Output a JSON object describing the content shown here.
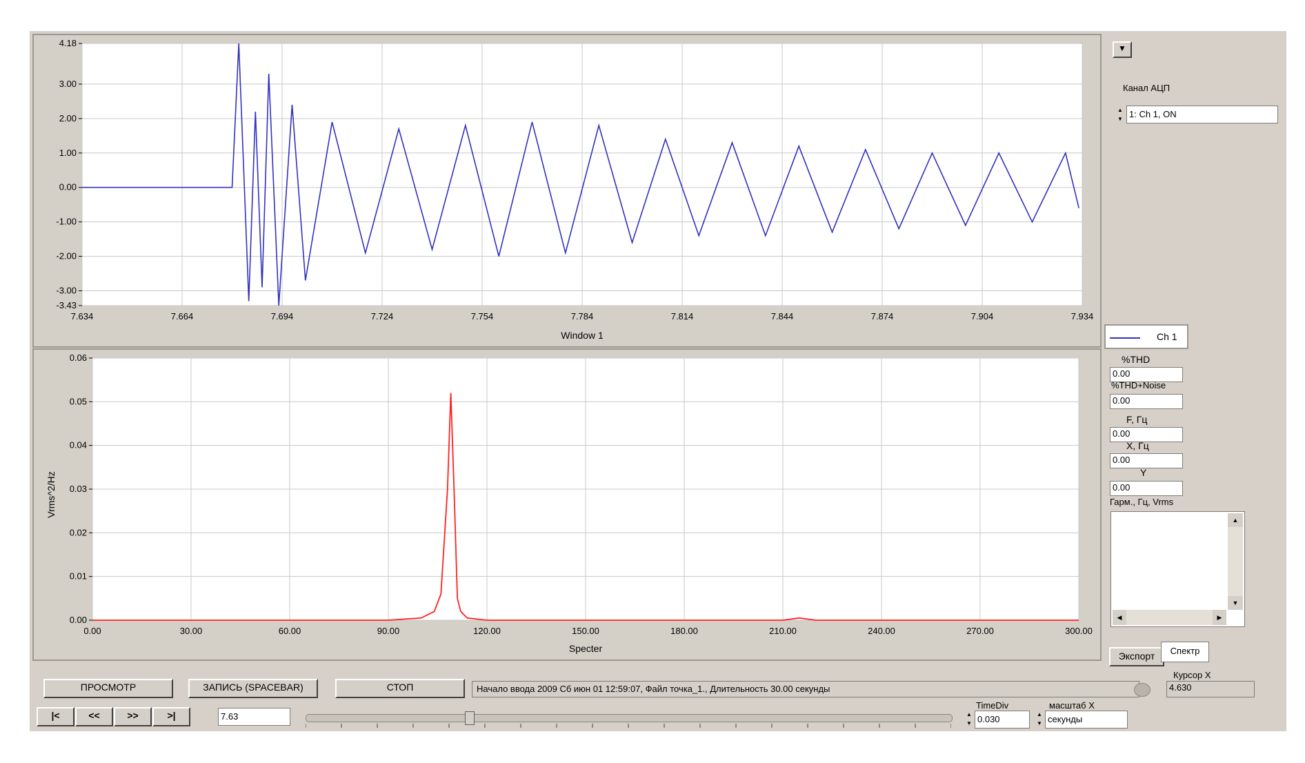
{
  "top_chart": {
    "xlabel": "Window 1",
    "y_ticks": [
      "4.18",
      "3.00",
      "2.00",
      "1.00",
      "0.00",
      "-1.00",
      "-2.00",
      "-3.00",
      "-3.43"
    ],
    "x_ticks": [
      "7.634",
      "7.664",
      "7.694",
      "7.724",
      "7.754",
      "7.784",
      "7.814",
      "7.844",
      "7.874",
      "7.904",
      "7.934"
    ],
    "line_color": "#3030c0"
  },
  "bottom_chart": {
    "xlabel": "Specter",
    "ylabel": "Vrms^2/Hz",
    "y_ticks": [
      "0.06",
      "0.05",
      "0.04",
      "0.03",
      "0.02",
      "0.01",
      "0.00"
    ],
    "x_ticks": [
      "0.00",
      "30.00",
      "60.00",
      "90.00",
      "120.00",
      "150.00",
      "180.00",
      "210.00",
      "240.00",
      "270.00",
      "300.00"
    ],
    "line_color": "#ff2020"
  },
  "chart_data": [
    {
      "type": "line",
      "x": [
        7.634,
        7.66,
        7.679,
        7.681,
        7.684,
        7.686,
        7.688,
        7.69,
        7.693,
        7.697,
        7.701,
        7.709,
        7.719,
        7.729,
        7.739,
        7.749,
        7.759,
        7.769,
        7.779,
        7.789,
        7.799,
        7.809,
        7.819,
        7.829,
        7.839,
        7.849,
        7.859,
        7.869,
        7.879,
        7.889,
        7.899,
        7.909,
        7.919,
        7.929,
        7.933
      ],
      "values": [
        0,
        0,
        0,
        4.18,
        -3.3,
        2.2,
        -2.9,
        3.3,
        -3.43,
        2.4,
        -2.7,
        1.9,
        -1.9,
        1.7,
        -1.8,
        1.8,
        -2.0,
        1.9,
        -1.9,
        1.8,
        -1.6,
        1.4,
        -1.4,
        1.3,
        -1.4,
        1.2,
        -1.3,
        1.1,
        -1.2,
        1.0,
        -1.1,
        1.0,
        -1.0,
        1.0,
        -0.6
      ],
      "xlabel": "Window 1",
      "xlim": [
        7.634,
        7.934
      ],
      "ylim": [
        -3.43,
        4.18
      ],
      "grid": true
    },
    {
      "type": "line",
      "x": [
        0,
        90,
        100,
        104,
        106,
        108,
        109,
        110,
        111,
        112,
        114,
        120,
        210,
        215,
        220,
        300
      ],
      "values": [
        0,
        0,
        0.0005,
        0.002,
        0.006,
        0.03,
        0.052,
        0.03,
        0.005,
        0.002,
        0.0005,
        0,
        0,
        0.0005,
        0,
        0
      ],
      "xlabel": "Specter",
      "ylabel": "Vrms^2/Hz",
      "xlim": [
        0,
        300
      ],
      "ylim": [
        0,
        0.06
      ],
      "grid": true
    }
  ],
  "side": {
    "channel_label": "Канал АЦП",
    "channel_value": "1:     Ch 1, ON",
    "legend_text": "Ch 1",
    "thd_label": "%THD",
    "thd_value": "0.00",
    "thdn_label": "%THD+Noise",
    "thdn_value": "0.00",
    "f_label": "F, Гц",
    "f_value": "0.00",
    "x_label": "X, Гц",
    "x_value": "0.00",
    "y_label": "Y",
    "y_value": "0.00",
    "harm_label": "Гарм., Гц, Vrms",
    "export_label": "Экспорт",
    "spectr_label": "Спектр"
  },
  "bottom": {
    "view_btn": "ПРОСМОТР",
    "record_btn": "ЗАПИСЬ (SPACEBAR)",
    "stop_btn": "СТОП",
    "status_text": "Начало ввода 2009 Сб июн 01 12:59:07, Файл точка_1., Длительность 30.00 секунды",
    "cursor_label": "Курсор X",
    "cursor_value": "4.630",
    "nav_first": "|<",
    "nav_prev": "<<",
    "nav_next": ">>",
    "nav_last": ">|",
    "position_value": "7.63",
    "slider_value": 0.25,
    "timediv_label": "TimeDiv",
    "timediv_value": "0.030",
    "scale_label": "масштаб X",
    "scale_value": "секунды"
  }
}
